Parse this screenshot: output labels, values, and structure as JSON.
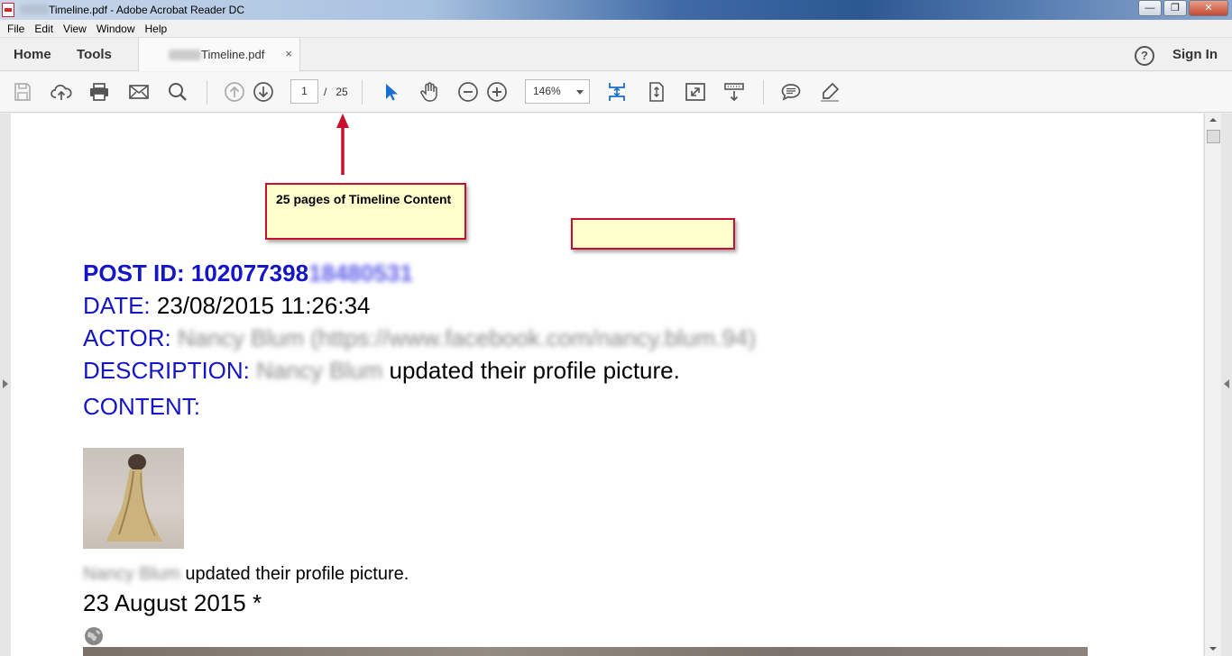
{
  "window": {
    "title": "Timeline.pdf - Adobe Acrobat Reader DC",
    "buttons": {
      "minimize": "—",
      "maximize": "❐",
      "close": "✕"
    }
  },
  "menu": [
    "File",
    "Edit",
    "View",
    "Window",
    "Help"
  ],
  "tabs": {
    "home": "Home",
    "tools": "Tools",
    "document": "Timeline.pdf",
    "close": "×",
    "help": "?",
    "sign_in": "Sign In"
  },
  "toolbar": {
    "current_page": "1",
    "page_sep": "/",
    "total_pages": "25",
    "zoom": "146%"
  },
  "annotations": {
    "callout_text": "25 pages of Timeline Content",
    "accent": "#c8102e",
    "note_bg": "#ffffcc"
  },
  "document": {
    "post_id_label": "POST ID: ",
    "post_id_visible": "102077398",
    "post_id_hidden": "18480531",
    "date_label": "DATE:",
    "date_value": " 23/08/2015 11:26:34",
    "actor_label": "ACTOR:",
    "actor_hidden": "Nancy Blum (https://www.facebook.com/nancy.blum.94)",
    "description_label": "DESCRIPTION:",
    "description_hidden": "Nancy Blum",
    "description_text": " updated their profile picture.",
    "content_label": "CONTENT:",
    "caption_hidden": "Nancy Blum",
    "caption_text": " updated their profile picture.",
    "date_line": "23 August 2015 *",
    "label_color": "#1515c8"
  }
}
